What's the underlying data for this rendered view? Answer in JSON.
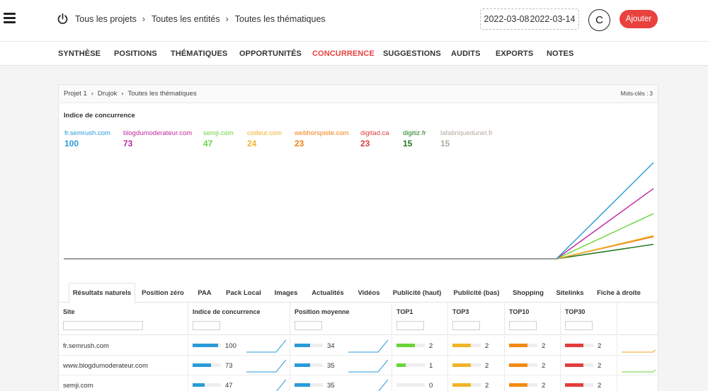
{
  "header": {
    "breadcrumb": [
      "Tous les projets",
      "Toutes les entités",
      "Toutes les thématiques"
    ],
    "date_start": "2022-03-08",
    "date_end": "2022-03-14",
    "avatar_initial": "C",
    "add_label": "Ajouter"
  },
  "nav": {
    "items": [
      "SYNTHÈSE",
      "POSITIONS",
      "THÉMATIQUES",
      "OPPORTUNITÉS",
      "CONCURRENCE",
      "SUGGESTIONS",
      "AUDITS",
      "EXPORTS",
      "NOTES"
    ],
    "active": "CONCURRENCE"
  },
  "card": {
    "breadcrumb": [
      "Projet 1",
      "Drujok",
      "Toutes les thématiques"
    ],
    "keywords": "Mots-clés : 3",
    "title": "Indice de concurrence"
  },
  "chart_data": {
    "type": "line",
    "series": [
      {
        "name": "fr.semrush.com",
        "value": 100,
        "color": "#2b9bd8"
      },
      {
        "name": "blogdumoderateur.com",
        "value": 73,
        "color": "#c0289f"
      },
      {
        "name": "semji.com",
        "value": 47,
        "color": "#6ad43a"
      },
      {
        "name": "codeur.com",
        "value": 24,
        "color": "#f0b429"
      },
      {
        "name": "webhorspiste.com",
        "value": 23,
        "color": "#f07f13"
      },
      {
        "name": "digitad.ca",
        "value": 23,
        "color": "#e33d3d"
      },
      {
        "name": "digitiz.fr",
        "value": 15,
        "color": "#1e7a1e"
      },
      {
        "name": "lafabriquedunet.fr",
        "value": 15,
        "color": "#b5aa9d"
      }
    ]
  },
  "tabs": [
    "Résultats naturels",
    "Position zéro",
    "PAA",
    "Pack Local",
    "Images",
    "Actualités",
    "Vidéos",
    "Publicité (haut)",
    "Publicité (bas)",
    "Shopping",
    "Sitelinks",
    "Fiche à droite"
  ],
  "table": {
    "columns": [
      "Site",
      "Indice de concurrence",
      "Position moyenne",
      "TOP1",
      "TOP3",
      "TOP10",
      "TOP30",
      ""
    ],
    "rows": [
      {
        "site": "fr.semrush.com",
        "indice": "100",
        "indice_pct": 1.0,
        "position": "34",
        "position_pct": 0.55,
        "top1": "2",
        "top1_pct": 0.65,
        "top3": "2",
        "top3_pct": 0.65,
        "top10": "2",
        "top10_pct": 0.65,
        "top30": "2",
        "top30_pct": 0.65,
        "extra_color": "#f0a020"
      },
      {
        "site": "www.blogdumoderateur.com",
        "indice": "73",
        "indice_pct": 0.73,
        "position": "35",
        "position_pct": 0.55,
        "top1": "1",
        "top1_pct": 0.32,
        "top3": "2",
        "top3_pct": 0.65,
        "top10": "2",
        "top10_pct": 0.65,
        "top30": "2",
        "top30_pct": 0.65,
        "extra_color": "#6ad43a"
      },
      {
        "site": "semji.com",
        "indice": "47",
        "indice_pct": 0.47,
        "position": "35",
        "position_pct": 0.55,
        "top1": "0",
        "top1_pct": 0.0,
        "top3": "2",
        "top3_pct": 0.65,
        "top10": "2",
        "top10_pct": 0.65,
        "top30": "2",
        "top30_pct": 0.65,
        "extra_color": ""
      }
    ]
  },
  "colors": {
    "accent": "#e8413e",
    "bar_indice": "#2b9bd8",
    "bar_position": "#2b9bd8",
    "bar_top1": "#6ad43a",
    "bar_top3": "#f0b429",
    "bar_top10": "#f08a13",
    "bar_top30": "#e33d3d"
  }
}
